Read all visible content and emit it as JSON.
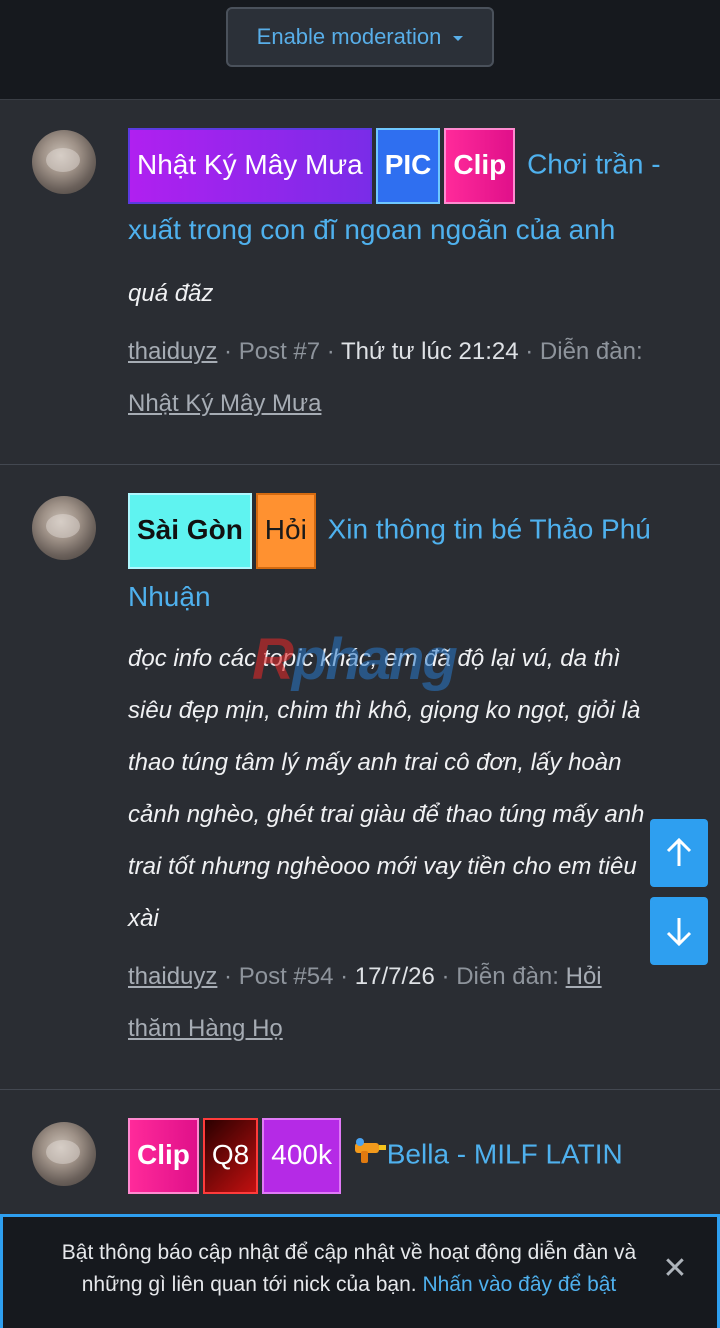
{
  "header": {
    "moderation_label": "Enable moderation"
  },
  "posts": [
    {
      "tags": [
        "Nhật Ký Mây Mưa",
        "PIC",
        "Clip"
      ],
      "title_1": "Chơi trần -",
      "title_2": "xuất trong con đĩ ngoan ngoãn của anh",
      "snippet": [
        "quá đãz"
      ],
      "author": "thaiduyz",
      "post_no": "Post #7",
      "time": "Thứ tư lúc 21:24",
      "forum_label": "Diễn đàn:",
      "forum": "Nhật Ký Mây Mưa"
    },
    {
      "tags": [
        "Sài Gòn",
        "Hỏi"
      ],
      "title_1": "Xin thông tin bé Thảo Phú",
      "title_2": "Nhuận",
      "snippet": [
        "đọc info các topic khác, em đã độ lại vú, da thì",
        "siêu đẹp mịn, chim thì khô, giọng ko ngọt, giỏi là",
        "thao túng tâm lý mấy anh trai cô đơn, lấy hoàn",
        "cảnh nghèo, ghét trai giàu để thao túng mấy anh",
        "trai tốt nhưng nghèooo mới vay tiền cho em tiêu",
        "xài"
      ],
      "author": "thaiduyz",
      "post_no": "Post #54",
      "time": "17/7/26",
      "forum_label": "Diễn đàn:",
      "forum_1": "Hỏi",
      "forum_2": "thăm Hàng Họ"
    },
    {
      "tags": [
        "Clip",
        "Q8",
        "400k"
      ],
      "title_1": "Bella - MILF LATIN"
    }
  ],
  "watermark": "Rphang",
  "notice": {
    "text_1": "Bật thông báo cập nhật để cập nhật về hoạt động diễn đàn và",
    "text_2": "những gì liên quan tới nick của bạn.",
    "link": "Nhấn vào đây để bật",
    "close": "✕"
  },
  "icons": [
    "arrow-up-icon",
    "arrow-down-icon",
    "close-icon",
    "water-gun-icon"
  ],
  "colors": {
    "accent": "#2e9ff0",
    "link": "#4fb1ee",
    "background": "#2a2d33"
  }
}
